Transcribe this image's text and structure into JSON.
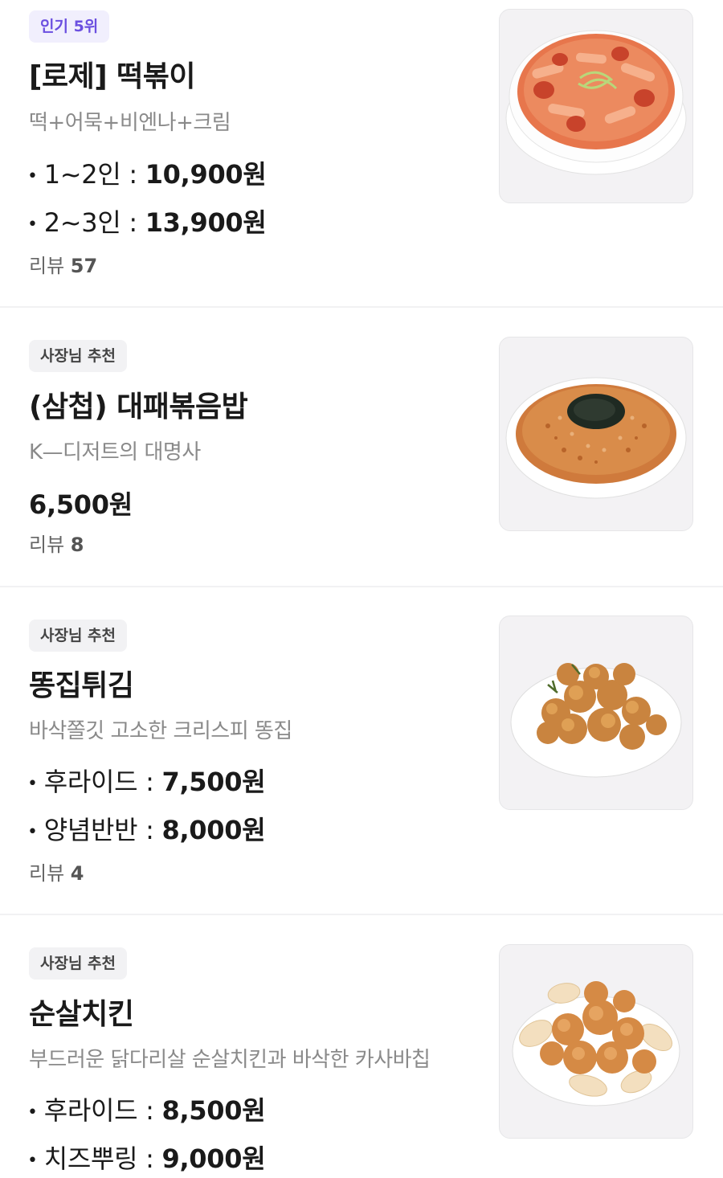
{
  "items": [
    {
      "badge": "인기 5위",
      "title": "[로제] 떡볶이",
      "description": "떡+어묵+비엔나+크림",
      "prices": [
        {
          "label": "1~2인 : ",
          "amount": "10,900원"
        },
        {
          "label": "2~3인 : ",
          "amount": "13,900원"
        }
      ],
      "review_label": "리뷰 ",
      "review_count": "57"
    },
    {
      "badge": "사장님 추천",
      "title": "(삼첩) 대패볶음밥",
      "description": "K—디저트의 대명사",
      "price": "6,500원",
      "review_label": "리뷰 ",
      "review_count": "8"
    },
    {
      "badge": "사장님 추천",
      "title": "똥집튀김",
      "description": "바삭쫄깃 고소한 크리스피 똥집",
      "prices": [
        {
          "label": "후라이드 : ",
          "amount": "7,500원"
        },
        {
          "label": "양념반반 : ",
          "amount": "8,000원"
        }
      ],
      "review_label": "리뷰 ",
      "review_count": "4"
    },
    {
      "badge": "사장님 추천",
      "title": "순살치킨",
      "description": "부드러운 닭다리살 순살치킨과 바삭한 카사바칩",
      "prices": [
        {
          "label": "후라이드 : ",
          "amount": "8,500원"
        },
        {
          "label": "치즈뿌링 : ",
          "amount": "9,000원"
        }
      ]
    }
  ],
  "colors": {
    "rank_badge_bg": "#f1effd",
    "rank_badge_text": "#6b4fe0",
    "rec_badge_bg": "#f2f2f4",
    "description_text": "#8a8a8a"
  }
}
